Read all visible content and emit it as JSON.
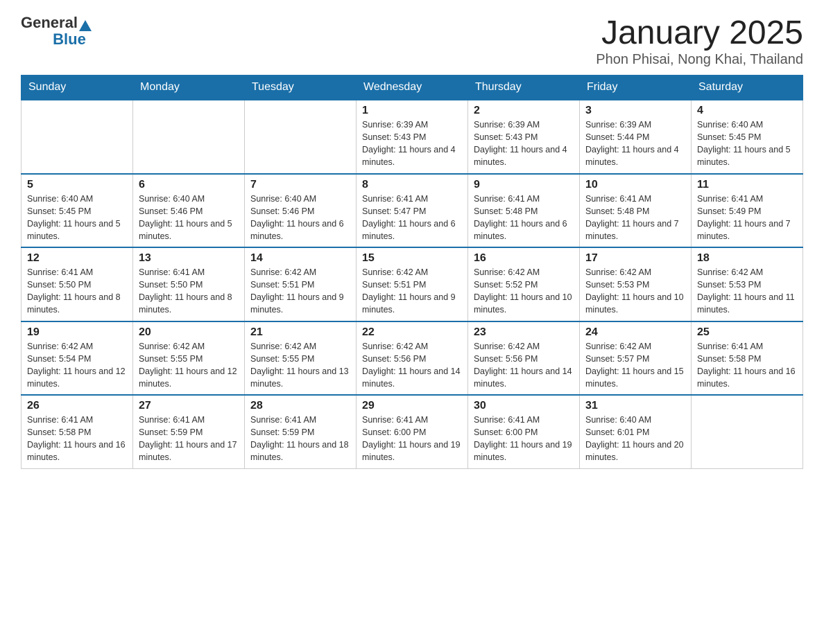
{
  "header": {
    "logo_general": "General",
    "logo_blue": "Blue",
    "title": "January 2025",
    "subtitle": "Phon Phisai, Nong Khai, Thailand"
  },
  "weekdays": [
    "Sunday",
    "Monday",
    "Tuesday",
    "Wednesday",
    "Thursday",
    "Friday",
    "Saturday"
  ],
  "weeks": [
    [
      {
        "day": "",
        "sunrise": "",
        "sunset": "",
        "daylight": ""
      },
      {
        "day": "",
        "sunrise": "",
        "sunset": "",
        "daylight": ""
      },
      {
        "day": "",
        "sunrise": "",
        "sunset": "",
        "daylight": ""
      },
      {
        "day": "1",
        "sunrise": "Sunrise: 6:39 AM",
        "sunset": "Sunset: 5:43 PM",
        "daylight": "Daylight: 11 hours and 4 minutes."
      },
      {
        "day": "2",
        "sunrise": "Sunrise: 6:39 AM",
        "sunset": "Sunset: 5:43 PM",
        "daylight": "Daylight: 11 hours and 4 minutes."
      },
      {
        "day": "3",
        "sunrise": "Sunrise: 6:39 AM",
        "sunset": "Sunset: 5:44 PM",
        "daylight": "Daylight: 11 hours and 4 minutes."
      },
      {
        "day": "4",
        "sunrise": "Sunrise: 6:40 AM",
        "sunset": "Sunset: 5:45 PM",
        "daylight": "Daylight: 11 hours and 5 minutes."
      }
    ],
    [
      {
        "day": "5",
        "sunrise": "Sunrise: 6:40 AM",
        "sunset": "Sunset: 5:45 PM",
        "daylight": "Daylight: 11 hours and 5 minutes."
      },
      {
        "day": "6",
        "sunrise": "Sunrise: 6:40 AM",
        "sunset": "Sunset: 5:46 PM",
        "daylight": "Daylight: 11 hours and 5 minutes."
      },
      {
        "day": "7",
        "sunrise": "Sunrise: 6:40 AM",
        "sunset": "Sunset: 5:46 PM",
        "daylight": "Daylight: 11 hours and 6 minutes."
      },
      {
        "day": "8",
        "sunrise": "Sunrise: 6:41 AM",
        "sunset": "Sunset: 5:47 PM",
        "daylight": "Daylight: 11 hours and 6 minutes."
      },
      {
        "day": "9",
        "sunrise": "Sunrise: 6:41 AM",
        "sunset": "Sunset: 5:48 PM",
        "daylight": "Daylight: 11 hours and 6 minutes."
      },
      {
        "day": "10",
        "sunrise": "Sunrise: 6:41 AM",
        "sunset": "Sunset: 5:48 PM",
        "daylight": "Daylight: 11 hours and 7 minutes."
      },
      {
        "day": "11",
        "sunrise": "Sunrise: 6:41 AM",
        "sunset": "Sunset: 5:49 PM",
        "daylight": "Daylight: 11 hours and 7 minutes."
      }
    ],
    [
      {
        "day": "12",
        "sunrise": "Sunrise: 6:41 AM",
        "sunset": "Sunset: 5:50 PM",
        "daylight": "Daylight: 11 hours and 8 minutes."
      },
      {
        "day": "13",
        "sunrise": "Sunrise: 6:41 AM",
        "sunset": "Sunset: 5:50 PM",
        "daylight": "Daylight: 11 hours and 8 minutes."
      },
      {
        "day": "14",
        "sunrise": "Sunrise: 6:42 AM",
        "sunset": "Sunset: 5:51 PM",
        "daylight": "Daylight: 11 hours and 9 minutes."
      },
      {
        "day": "15",
        "sunrise": "Sunrise: 6:42 AM",
        "sunset": "Sunset: 5:51 PM",
        "daylight": "Daylight: 11 hours and 9 minutes."
      },
      {
        "day": "16",
        "sunrise": "Sunrise: 6:42 AM",
        "sunset": "Sunset: 5:52 PM",
        "daylight": "Daylight: 11 hours and 10 minutes."
      },
      {
        "day": "17",
        "sunrise": "Sunrise: 6:42 AM",
        "sunset": "Sunset: 5:53 PM",
        "daylight": "Daylight: 11 hours and 10 minutes."
      },
      {
        "day": "18",
        "sunrise": "Sunrise: 6:42 AM",
        "sunset": "Sunset: 5:53 PM",
        "daylight": "Daylight: 11 hours and 11 minutes."
      }
    ],
    [
      {
        "day": "19",
        "sunrise": "Sunrise: 6:42 AM",
        "sunset": "Sunset: 5:54 PM",
        "daylight": "Daylight: 11 hours and 12 minutes."
      },
      {
        "day": "20",
        "sunrise": "Sunrise: 6:42 AM",
        "sunset": "Sunset: 5:55 PM",
        "daylight": "Daylight: 11 hours and 12 minutes."
      },
      {
        "day": "21",
        "sunrise": "Sunrise: 6:42 AM",
        "sunset": "Sunset: 5:55 PM",
        "daylight": "Daylight: 11 hours and 13 minutes."
      },
      {
        "day": "22",
        "sunrise": "Sunrise: 6:42 AM",
        "sunset": "Sunset: 5:56 PM",
        "daylight": "Daylight: 11 hours and 14 minutes."
      },
      {
        "day": "23",
        "sunrise": "Sunrise: 6:42 AM",
        "sunset": "Sunset: 5:56 PM",
        "daylight": "Daylight: 11 hours and 14 minutes."
      },
      {
        "day": "24",
        "sunrise": "Sunrise: 6:42 AM",
        "sunset": "Sunset: 5:57 PM",
        "daylight": "Daylight: 11 hours and 15 minutes."
      },
      {
        "day": "25",
        "sunrise": "Sunrise: 6:41 AM",
        "sunset": "Sunset: 5:58 PM",
        "daylight": "Daylight: 11 hours and 16 minutes."
      }
    ],
    [
      {
        "day": "26",
        "sunrise": "Sunrise: 6:41 AM",
        "sunset": "Sunset: 5:58 PM",
        "daylight": "Daylight: 11 hours and 16 minutes."
      },
      {
        "day": "27",
        "sunrise": "Sunrise: 6:41 AM",
        "sunset": "Sunset: 5:59 PM",
        "daylight": "Daylight: 11 hours and 17 minutes."
      },
      {
        "day": "28",
        "sunrise": "Sunrise: 6:41 AM",
        "sunset": "Sunset: 5:59 PM",
        "daylight": "Daylight: 11 hours and 18 minutes."
      },
      {
        "day": "29",
        "sunrise": "Sunrise: 6:41 AM",
        "sunset": "Sunset: 6:00 PM",
        "daylight": "Daylight: 11 hours and 19 minutes."
      },
      {
        "day": "30",
        "sunrise": "Sunrise: 6:41 AM",
        "sunset": "Sunset: 6:00 PM",
        "daylight": "Daylight: 11 hours and 19 minutes."
      },
      {
        "day": "31",
        "sunrise": "Sunrise: 6:40 AM",
        "sunset": "Sunset: 6:01 PM",
        "daylight": "Daylight: 11 hours and 20 minutes."
      },
      {
        "day": "",
        "sunrise": "",
        "sunset": "",
        "daylight": ""
      }
    ]
  ]
}
